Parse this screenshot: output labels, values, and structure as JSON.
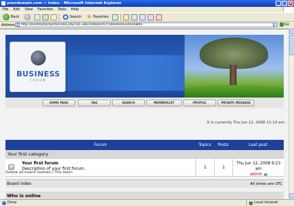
{
  "window": {
    "title": "yourdomain.com :: Index - Microsoft Internet Explorer"
  },
  "menu": {
    "items": [
      "File",
      "Edit",
      "View",
      "Favorites",
      "Tools",
      "Help"
    ]
  },
  "toolbar": {
    "back_label": "Back",
    "search_label": "Search",
    "favorites_label": "Favorites"
  },
  "address": {
    "label": "Address",
    "url": "http://localhost/projects/index.php?sid=a81c0d0a01f47c5d4e4a0d31b54a8df2",
    "go_label": "Go"
  },
  "header": {
    "logo_title": "BUSINESS",
    "logo_subtitle": "FORUM"
  },
  "nav": {
    "items": [
      "HOME PAGE",
      "FAQ",
      "SEARCH",
      "MEMBERLIST",
      "PROFILE",
      "PRIVATE MESSAGE"
    ]
  },
  "forum": {
    "current_time": "It is currently Thu Jun 12, 2008 11:13 am",
    "columns": {
      "forum": "Forum",
      "topics": "Topics",
      "posts": "Posts",
      "last_post": "Last post"
    },
    "category": "Your first category",
    "rows": [
      {
        "title": "Your first forum",
        "description": "Description of your first forum.",
        "topics": "1",
        "posts": "1",
        "last_post_date": "Thu Jun 12, 2008 9:23 am",
        "last_post_author": "admin"
      }
    ],
    "footer_links": "Delete all board cookies | The team",
    "board_index": "Board index",
    "timezone": "All times are UTC",
    "who_is_online": "Who is online"
  },
  "status": {
    "left": "Done",
    "zone": "Local intranet"
  }
}
